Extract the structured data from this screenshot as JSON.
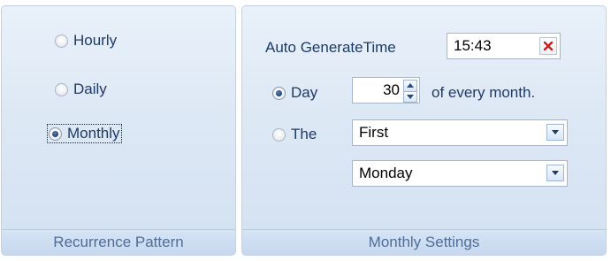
{
  "recurrence_pattern": {
    "caption": "Recurrence Pattern",
    "options": [
      {
        "label": "Hourly",
        "checked": false
      },
      {
        "label": "Daily",
        "checked": false
      },
      {
        "label": "Monthly",
        "checked": true
      }
    ]
  },
  "monthly_settings": {
    "caption": "Monthly Settings",
    "auto_generate_label": "Auto GenerateTime",
    "time_value": "15:43",
    "day_option_label": "Day",
    "day_value": "30",
    "day_suffix": "of every month.",
    "the_option_label": "The",
    "ordinal_value": "First",
    "weekday_value": "Monday"
  },
  "colors": {
    "clear_icon": "#c8201c",
    "label_text": "#1e3a66",
    "caption_text": "#4f6d97"
  },
  "icons": {
    "clear": "close-icon",
    "dropdown": "chevron-down-icon",
    "spin_up": "triangle-up-icon",
    "spin_down": "triangle-down-icon"
  }
}
